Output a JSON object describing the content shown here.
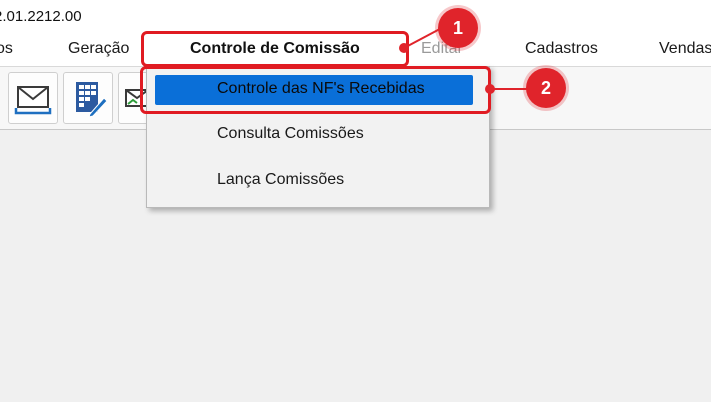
{
  "window": {
    "title": "2.01.2212.00"
  },
  "menubar": {
    "items": [
      {
        "id": "prev",
        "label": "os"
      },
      {
        "id": "geracao",
        "label": "Geração"
      },
      {
        "id": "controle",
        "label": "Controle de Comissão"
      },
      {
        "id": "editar",
        "label": "Editar"
      },
      {
        "id": "cadastros",
        "label": "Cadastros"
      },
      {
        "id": "vendas",
        "label": "Vendas"
      }
    ]
  },
  "toolbar": {
    "buttons": [
      {
        "icon": "envelope-icon"
      },
      {
        "icon": "calculator-edit-icon"
      },
      {
        "icon": "envelope-chart-icon"
      }
    ]
  },
  "dropdown": {
    "items": [
      {
        "label": "Controle das NF's Recebidas",
        "selected": true
      },
      {
        "label": "Consulta Comissões",
        "selected": false
      },
      {
        "label": "Lança Comissões",
        "selected": false
      }
    ]
  },
  "annotations": {
    "badge1": "1",
    "badge2": "2",
    "accent_color": "#e0242b",
    "selection_color": "#0a6fd8"
  }
}
